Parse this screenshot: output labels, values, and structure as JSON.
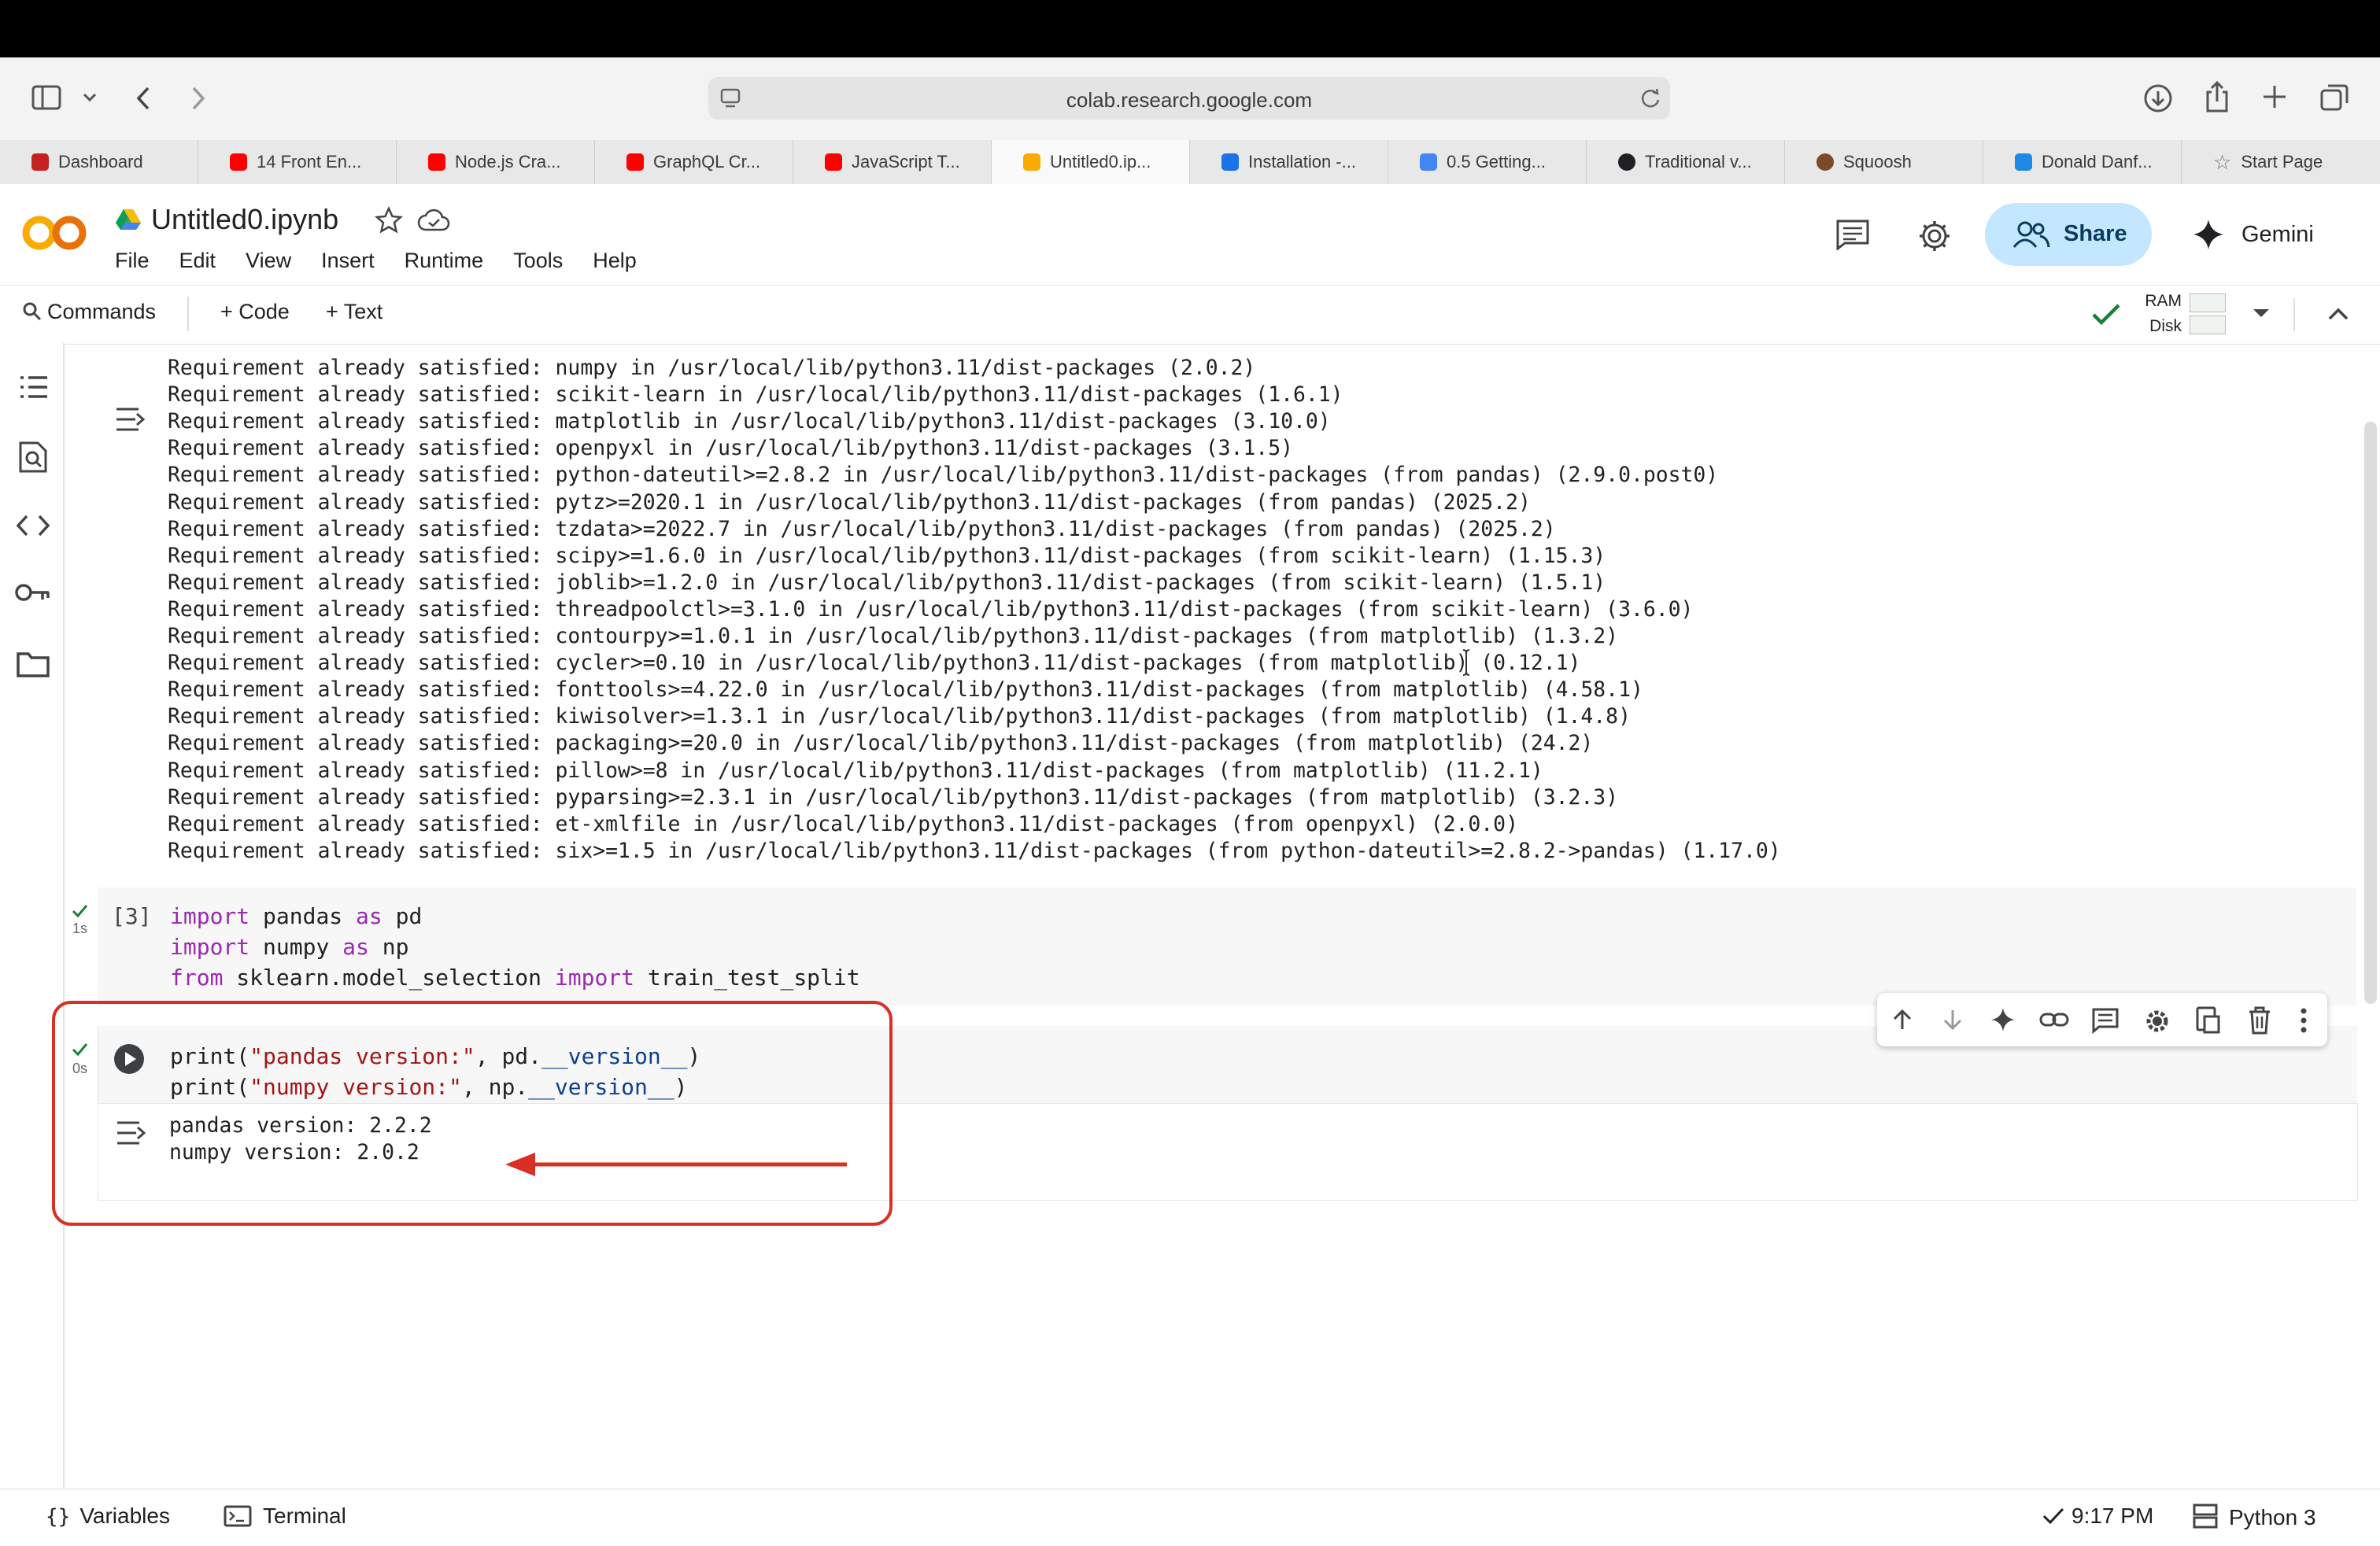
{
  "browser": {
    "url": "colab.research.google.com",
    "tabs": [
      {
        "label": "Dashboard",
        "color": "#c5221f"
      },
      {
        "label": "14 Front En...",
        "color": "#ff0000"
      },
      {
        "label": "Node.js Cra...",
        "color": "#ff0000"
      },
      {
        "label": "GraphQL Cr...",
        "color": "#ff0000"
      },
      {
        "label": "JavaScript T...",
        "color": "#ff0000"
      },
      {
        "label": "Untitled0.ip...",
        "color": "#f9ab00"
      },
      {
        "label": "Installation -...",
        "color": "#1a73e8"
      },
      {
        "label": "0.5 Getting...",
        "color": "#4285f4"
      },
      {
        "label": "Traditional v...",
        "color": "#202124"
      },
      {
        "label": "Squoosh",
        "color": "#7a4a2a"
      },
      {
        "label": "Donald Danf...",
        "color": "#1e88e5"
      },
      {
        "label": "Start Page",
        "color": "#777777"
      }
    ]
  },
  "notebook": {
    "title": "Untitled0.ipynb",
    "menu": [
      "File",
      "Edit",
      "View",
      "Insert",
      "Runtime",
      "Tools",
      "Help"
    ],
    "share_label": "Share",
    "gemini_label": "Gemini"
  },
  "toolbar": {
    "commands_label": "Commands",
    "add_code_label": "+ Code",
    "add_text_label": "+ Text",
    "ram_label": "RAM",
    "disk_label": "Disk"
  },
  "output_lines": [
    "Requirement already satisfied: numpy in /usr/local/lib/python3.11/dist-packages (2.0.2)",
    "Requirement already satisfied: scikit-learn in /usr/local/lib/python3.11/dist-packages (1.6.1)",
    "Requirement already satisfied: matplotlib in /usr/local/lib/python3.11/dist-packages (3.10.0)",
    "Requirement already satisfied: openpyxl in /usr/local/lib/python3.11/dist-packages (3.1.5)",
    "Requirement already satisfied: python-dateutil>=2.8.2 in /usr/local/lib/python3.11/dist-packages (from pandas) (2.9.0.post0)",
    "Requirement already satisfied: pytz>=2020.1 in /usr/local/lib/python3.11/dist-packages (from pandas) (2025.2)",
    "Requirement already satisfied: tzdata>=2022.7 in /usr/local/lib/python3.11/dist-packages (from pandas) (2025.2)",
    "Requirement already satisfied: scipy>=1.6.0 in /usr/local/lib/python3.11/dist-packages (from scikit-learn) (1.15.3)",
    "Requirement already satisfied: joblib>=1.2.0 in /usr/local/lib/python3.11/dist-packages (from scikit-learn) (1.5.1)",
    "Requirement already satisfied: threadpoolctl>=3.1.0 in /usr/local/lib/python3.11/dist-packages (from scikit-learn) (3.6.0)",
    "Requirement already satisfied: contourpy>=1.0.1 in /usr/local/lib/python3.11/dist-packages (from matplotlib) (1.3.2)",
    "Requirement already satisfied: cycler>=0.10 in /usr/local/lib/python3.11/dist-packages (from matplotlib) (0.12.1)",
    "Requirement already satisfied: fonttools>=4.22.0 in /usr/local/lib/python3.11/dist-packages (from matplotlib) (4.58.1)",
    "Requirement already satisfied: kiwisolver>=1.3.1 in /usr/local/lib/python3.11/dist-packages (from matplotlib) (1.4.8)",
    "Requirement already satisfied: packaging>=20.0 in /usr/local/lib/python3.11/dist-packages (from matplotlib) (24.2)",
    "Requirement already satisfied: pillow>=8 in /usr/local/lib/python3.11/dist-packages (from matplotlib) (11.2.1)",
    "Requirement already satisfied: pyparsing>=2.3.1 in /usr/local/lib/python3.11/dist-packages (from matplotlib) (3.2.3)",
    "Requirement already satisfied: et-xmlfile in /usr/local/lib/python3.11/dist-packages (from openpyxl) (2.0.0)",
    "Requirement already satisfied: six>=1.5 in /usr/local/lib/python3.11/dist-packages (from python-dateutil>=2.8.2->pandas) (1.17.0)"
  ],
  "cell3": {
    "exec_count": "[3]",
    "time": "1s",
    "lines": [
      [
        {
          "t": "import",
          "c": "kw"
        },
        {
          "t": " pandas ",
          "c": ""
        },
        {
          "t": "as",
          "c": "kw"
        },
        {
          "t": " pd",
          "c": ""
        }
      ],
      [
        {
          "t": "import",
          "c": "kw"
        },
        {
          "t": " numpy ",
          "c": ""
        },
        {
          "t": "as",
          "c": "kw"
        },
        {
          "t": " np",
          "c": ""
        }
      ],
      [
        {
          "t": "from",
          "c": "kw"
        },
        {
          "t": " sklearn.model_selection ",
          "c": ""
        },
        {
          "t": "import",
          "c": "kw"
        },
        {
          "t": " train_test_split",
          "c": ""
        }
      ]
    ]
  },
  "cell4": {
    "time": "0s",
    "lines": [
      [
        {
          "t": "print(",
          "c": ""
        },
        {
          "t": "\"pandas version:\"",
          "c": "str"
        },
        {
          "t": ", pd.",
          "c": ""
        },
        {
          "t": "__version__",
          "c": "pm"
        },
        {
          "t": ")",
          "c": ""
        }
      ],
      [
        {
          "t": "print(",
          "c": ""
        },
        {
          "t": "\"numpy version:\"",
          "c": "str"
        },
        {
          "t": ", np.",
          "c": ""
        },
        {
          "t": "__version__",
          "c": "pm"
        },
        {
          "t": ")",
          "c": ""
        }
      ]
    ],
    "output": [
      "pandas version: 2.2.2",
      "numpy version: 2.0.2"
    ]
  },
  "status": {
    "variables_label": "Variables",
    "terminal_label": "Terminal",
    "time": "9:17 PM",
    "runtime": "Python 3"
  },
  "colors": {
    "accent_red": "#d93025",
    "share_bg": "#c2e7ff",
    "keyword": "#9c27b0",
    "string": "#a31515"
  }
}
